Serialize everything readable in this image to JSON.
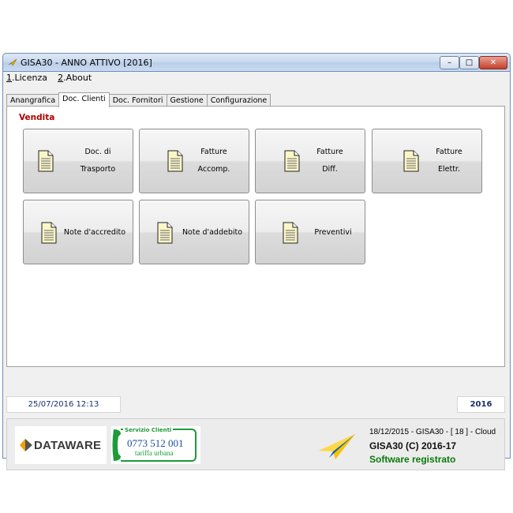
{
  "window": {
    "title": "GISA30 - ANNO ATTIVO  [2016]",
    "controls": {
      "minimize": "–",
      "maximize": "□",
      "close": "✕"
    }
  },
  "menu": [
    {
      "accel": "1",
      "label": ".Licenza"
    },
    {
      "accel": "2",
      "label": ".About"
    }
  ],
  "tabs": [
    "Anangrafica",
    "Doc. Clienti",
    "Doc. Fornitori",
    "Gestione",
    "Configurazione"
  ],
  "active_tab": "Doc. Clienti",
  "section": {
    "title": "Vendita"
  },
  "buttons": [
    {
      "line1": "Doc. di",
      "line2": "Trasporto"
    },
    {
      "line1": "Fatture",
      "line2": "Accomp."
    },
    {
      "line1": "Fatture",
      "line2": "Diff."
    },
    {
      "line1": "Fatture",
      "line2": "Elettr."
    },
    {
      "line1": "Note d'accredito",
      "line2": ""
    },
    {
      "line1": "Note d'addebito",
      "line2": ""
    },
    {
      "line1": "Preventivi",
      "line2": ""
    }
  ],
  "icons": {
    "document": "document-icon",
    "app": "gisa-app-icon",
    "logo": "paper-plane-logo",
    "phone": "phone-handset-icon"
  },
  "status": {
    "datetime": "25/07/2016  12:13",
    "year": "2016"
  },
  "footer": {
    "brand": "DATAWARE",
    "service": {
      "label": "Servizio Clienti",
      "phone": "0773 512 001",
      "rate": "tariffa urbana"
    },
    "build": "18/12/2015 - GISA30 - [ 18 ]  - Cloud",
    "product": "GISA30 (C) 2016-17",
    "license": "Software registrato"
  },
  "colors": {
    "section_title": "#b00000",
    "year": "#1a2f6b",
    "license": "#0a7a0a",
    "service_green": "#1e9a3a",
    "phone_blue": "#1b4f9c"
  }
}
